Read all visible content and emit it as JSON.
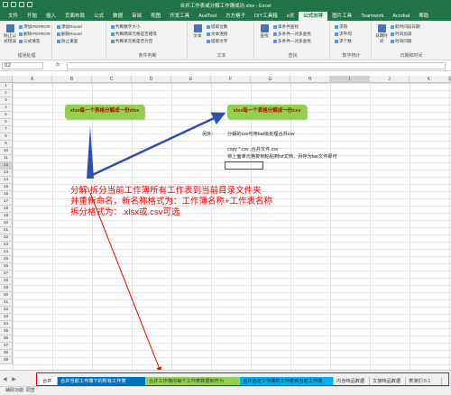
{
  "window": {
    "title": "合并工作表或分解工作簿成功.xlsx - Excel",
    "qat": [
      "save",
      "undo",
      "redo",
      "customize"
    ]
  },
  "menu_tabs": [
    "文件",
    "开始",
    "插入",
    "页面布局",
    "公式",
    "数据",
    "审阅",
    "视图",
    "开发工具",
    "AudTool",
    "方方格子",
    "DIY工具箱",
    "e灵",
    "公式向导",
    "图片工具",
    "Teamwork",
    "Acrobat",
    "帮助"
  ],
  "ribbon": {
    "groups": [
      {
        "name": "错误处理",
        "items": [
          "添加IFERROR",
          "删除IFERROR",
          "公式填充"
        ],
        "big": [
          "防止公式错误"
        ]
      },
      {
        "name": "",
        "items": [
          "添加Round",
          "删除Round",
          "防止重复"
        ]
      },
      {
        "name": "条件判断",
        "items": [
          "判断数字大小",
          "判断两单元格是否相等",
          "判断单元格是否为空"
        ]
      },
      {
        "name": "文本",
        "items": [
          "提取位数",
          "文本连接",
          "提取文字"
        ],
        "big": [
          "文本",
          "替换"
        ]
      },
      {
        "name": "查找",
        "items": [
          "单条件查找",
          "多条件一对多查找",
          "多条件一对多查找"
        ],
        "big": [
          "查找"
        ]
      },
      {
        "name": "数学统计",
        "items": [
          "求和",
          "求平均",
          "求个数"
        ]
      },
      {
        "name": "日期和时间",
        "items": [
          "取时间段日期",
          "时间加减",
          "时间间隔"
        ],
        "big": [
          "日期时间"
        ]
      }
    ]
  },
  "formula_bar": {
    "name_box": "I12",
    "fx": "fx",
    "value": ""
  },
  "grid": {
    "columns": [
      "A",
      "B",
      "C",
      "D",
      "E",
      "F",
      "G",
      "H",
      "I",
      "J",
      "K",
      "L"
    ],
    "selected_column": "I",
    "rows": [
      "1",
      "2",
      "3",
      "4",
      "5",
      "6",
      "7",
      "8",
      "9",
      "10",
      "11",
      "12",
      "13",
      "14",
      "15",
      "16",
      "17",
      "18",
      "19",
      "20",
      "21",
      "22",
      "23",
      "24",
      "25",
      "26",
      "27",
      "28",
      "29",
      "30",
      "31",
      "32",
      "33",
      "34",
      "35",
      "36",
      "37",
      "38",
      "39"
    ],
    "selected_row": "12"
  },
  "buttons": {
    "left_green": "xlsx每一个表格分解成一份xlsx",
    "right_green": "xlsx每一个表格分解成一份csv"
  },
  "notes": {
    "label": "另外：",
    "line1": "分解的csv可用bat批处理合并csv",
    "line2": "copy *.csv  ,合并文件.csv",
    "line3": "将上面单元格复制粘贴到txt文档，另存为bat文件即可"
  },
  "description": {
    "line1": "分解\\拆分当前工作簿所有工作表到当前目录文件夹",
    "line2": "并重新命名，新名称格式为：工作簿名称+工作表名称",
    "line3": "拆分格式为：.xlsx或.csv可选"
  },
  "sheet_tabs": [
    {
      "label": "合并",
      "style": "white"
    },
    {
      "label": "合并当前工作簿下的所有工作表",
      "style": "blue"
    },
    {
      "label": "合并工作簿内每个工作表数据到开为",
      "style": "green"
    },
    {
      "label": "合并选定工作簿的工作表到当前工作簿",
      "style": "cyan"
    },
    {
      "label": "内含特品数据",
      "style": "plain"
    },
    {
      "label": "文旅特品数据",
      "style": "plain"
    },
    {
      "label": "表演们:5:1",
      "style": "plain"
    }
  ],
  "status_bar": {
    "text": "辅助功能: 调查"
  },
  "colors": {
    "excel_green": "#217346",
    "button_green": "#92d050",
    "annotation_red": "#ff0000",
    "arrow_blue": "#2f4fb5"
  }
}
